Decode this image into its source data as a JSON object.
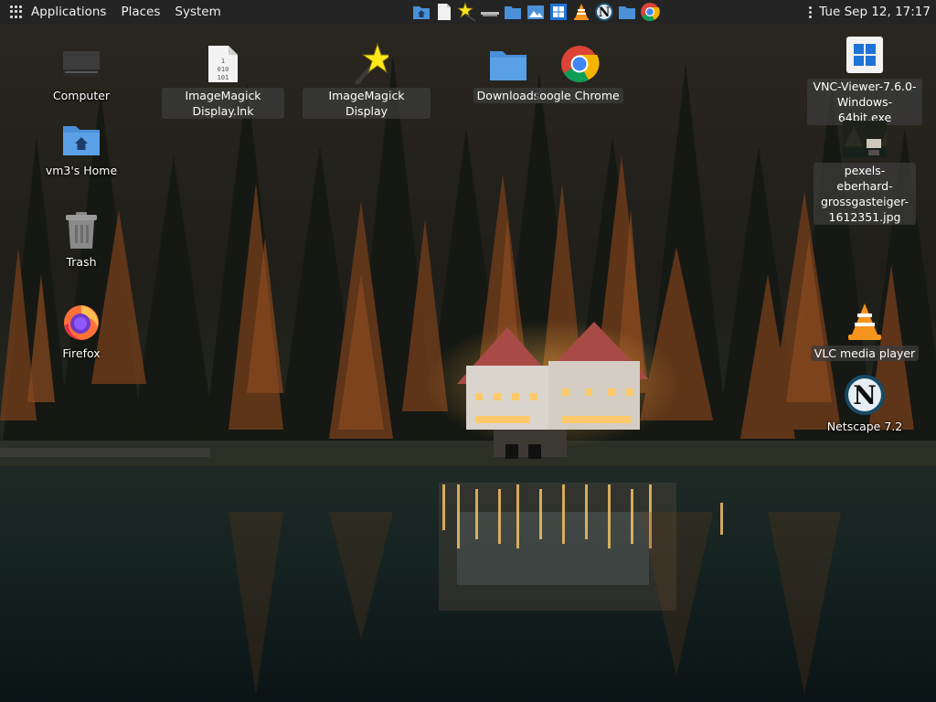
{
  "panel": {
    "menus": [
      "Applications",
      "Places",
      "System"
    ],
    "clock": "Tue Sep 12, 17:17",
    "tasks": [
      "home-folder-icon",
      "document-icon",
      "imagemagick-star-icon",
      "computer-icon",
      "folder-icon",
      "image-viewer-icon",
      "windows-installer-icon",
      "vlc-icon",
      "netscape-icon",
      "folder-icon",
      "chrome-icon"
    ]
  },
  "desktop": {
    "left": [
      {
        "label": "Computer",
        "icon": "computer-icon"
      },
      {
        "label": "vm3's Home",
        "icon": "home-folder-icon"
      },
      {
        "label": "Trash",
        "icon": "trash-icon"
      },
      {
        "label": "Firefox",
        "icon": "firefox-icon"
      }
    ],
    "top": [
      {
        "label": "ImageMagick Display.lnk",
        "icon": "binary-file-icon"
      },
      {
        "label": "ImageMagick Display",
        "icon": "imagemagick-star-icon"
      },
      {
        "label": "Downloads",
        "icon": "folder-icon"
      },
      {
        "label": "oogle Chrome",
        "icon": "chrome-icon"
      }
    ],
    "right": [
      {
        "label": "VNC-Viewer-7.6.0-Windows-64bit.exe",
        "icon": "windows-installer-icon"
      },
      {
        "label": "pexels-eberhard-grossgasteiger-1612351.jpg",
        "icon": "image-thumbnail-icon"
      },
      {
        "label": "VLC media player",
        "icon": "vlc-icon"
      },
      {
        "label": "Netscape 7.2",
        "icon": "netscape-icon"
      }
    ]
  },
  "colors": {
    "panel_bg": "#242424",
    "folder_blue": "#4a90d9",
    "label_selected_bg": "#3c3c3c"
  }
}
